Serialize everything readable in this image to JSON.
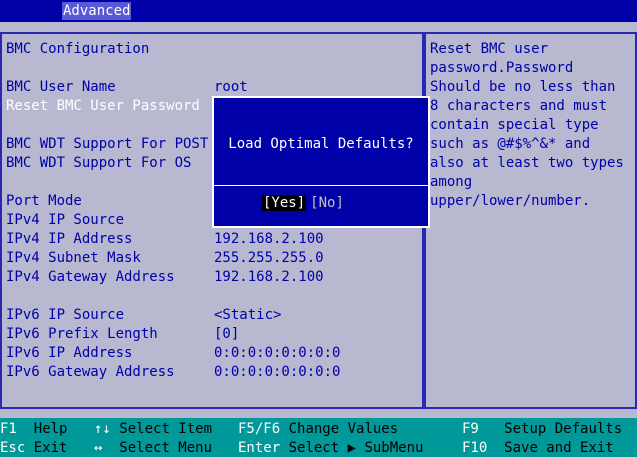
{
  "header": {
    "active_tab": "Advanced"
  },
  "section_title": "BMC Configuration",
  "items": [
    {
      "label": "BMC User Name",
      "value": "root"
    },
    {
      "label": "Reset BMC User Password",
      "value": ""
    },
    {
      "label": "BMC WDT Support For POST",
      "value": ""
    },
    {
      "label": "BMC WDT Support For OS",
      "value": ""
    },
    {
      "label": "Port Mode",
      "value": ""
    },
    {
      "label": "IPv4 IP Source",
      "value": ""
    },
    {
      "label": "IPv4 IP Address",
      "value": "192.168.2.100"
    },
    {
      "label": "IPv4 Subnet Mask",
      "value": "255.255.255.0"
    },
    {
      "label": "IPv4 Gateway Address",
      "value": "192.168.2.100"
    },
    {
      "label": "IPv6 IP Source",
      "value": "<Static>"
    },
    {
      "label": "IPv6 Prefix Length",
      "value": "[0]"
    },
    {
      "label": "IPv6 IP Address",
      "value": "0:0:0:0:0:0:0:0"
    },
    {
      "label": "IPv6 Gateway Address",
      "value": "0:0:0:0:0:0:0:0"
    }
  ],
  "help_lines": [
    "Reset BMC user",
    "password.Password",
    "Should be no less than",
    "8 characters and must",
    "contain special type",
    "such as @#$%^&* and",
    "also at least two types",
    "among",
    "upper/lower/number."
  ],
  "dialog": {
    "title": "Load Optimal Defaults?",
    "yes": "[Yes]",
    "no": "[No]"
  },
  "footer": [
    {
      "key": "F1",
      "desc": "Help"
    },
    {
      "key": "Esc",
      "desc": "Exit"
    },
    {
      "key": "↑↓",
      "desc": "Select Item"
    },
    {
      "key": "↔",
      "desc": "Select Menu"
    },
    {
      "key": "F5/F6",
      "desc": "Change Values"
    },
    {
      "key": "Enter",
      "desc": "Select ▶ SubMenu"
    },
    {
      "key": "F9",
      "desc": "Setup Defaults"
    },
    {
      "key": "F10",
      "desc": "Save and Exit"
    }
  ]
}
